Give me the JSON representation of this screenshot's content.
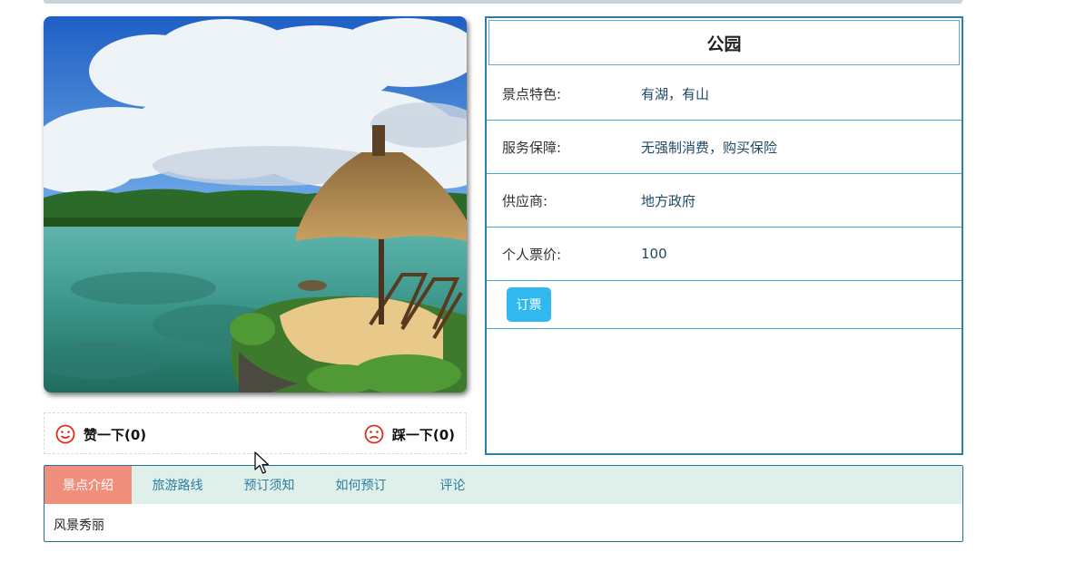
{
  "spot": {
    "name": "公园",
    "feature_label": "景点特色:",
    "feature_value": "有湖，有山",
    "service_label": "服务保障:",
    "service_value": "无强制消费，购买保险",
    "supplier_label": "供应商:",
    "supplier_value": "地方政府",
    "price_label": "个人票价:",
    "price_value": "100",
    "book_label": "订票"
  },
  "votes": {
    "like_label": "赞一下(0)",
    "dislike_label": "踩一下(0)"
  },
  "tabs": [
    {
      "label": "景点介绍",
      "active": true
    },
    {
      "label": "旅游路线",
      "active": false
    },
    {
      "label": "预订须知",
      "active": false
    },
    {
      "label": "如何预订",
      "active": false
    },
    {
      "label": "评论",
      "active": false
    }
  ],
  "tab_content": "风景秀丽",
  "icons": {
    "like": "smiley-icon",
    "dislike": "sad-face-icon"
  },
  "colors": {
    "accent_blue": "#31b9ef",
    "border_blue": "#2a7fa8",
    "active_tab": "#f0907c",
    "tab_bar_bg": "#dff0ea",
    "vote_icon": "#d8301f"
  }
}
